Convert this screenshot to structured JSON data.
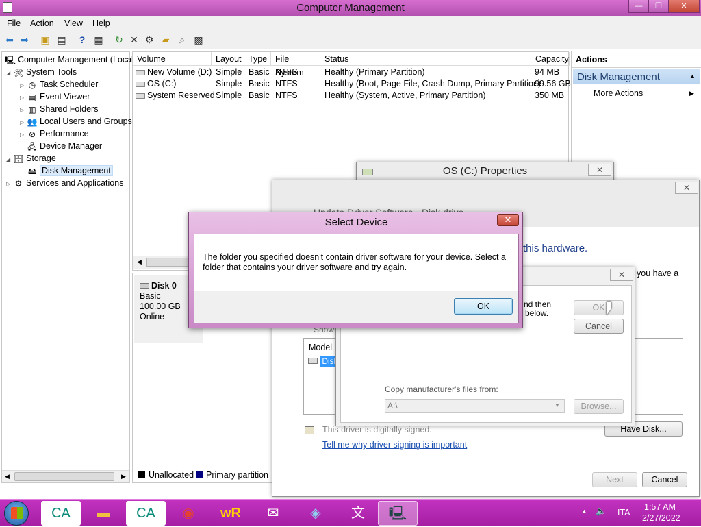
{
  "window": {
    "title": "Computer Management",
    "buttons": {
      "minimize": "—",
      "restore": "❐",
      "close": "✕"
    }
  },
  "menu": [
    "File",
    "Action",
    "View",
    "Help"
  ],
  "toolbar_icons": [
    "back-arrow-icon",
    "forward-arrow-icon",
    "up-folder-icon",
    "show-hide-tree-icon",
    "help-icon",
    "properties-icon",
    "refresh-icon",
    "delete-icon",
    "settings-icon",
    "open-folder-icon",
    "search-icon",
    "disk-icon"
  ],
  "tree": [
    {
      "label": "Computer Management (Local",
      "level": 0,
      "exp": ""
    },
    {
      "label": "System Tools",
      "level": 1,
      "exp": "◢"
    },
    {
      "label": "Task Scheduler",
      "level": 2,
      "exp": "▷"
    },
    {
      "label": "Event Viewer",
      "level": 2,
      "exp": "▷"
    },
    {
      "label": "Shared Folders",
      "level": 2,
      "exp": "▷"
    },
    {
      "label": "Local Users and Groups",
      "level": 2,
      "exp": "▷"
    },
    {
      "label": "Performance",
      "level": 2,
      "exp": "▷"
    },
    {
      "label": "Device Manager",
      "level": 2,
      "exp": ""
    },
    {
      "label": "Storage",
      "level": 1,
      "exp": "◢"
    },
    {
      "label": "Disk Management",
      "level": 2,
      "exp": "",
      "selected": true
    },
    {
      "label": "Services and Applications",
      "level": 1,
      "exp": "▷"
    }
  ],
  "volumes": {
    "headers": [
      "Volume",
      "Layout",
      "Type",
      "File System",
      "Status",
      "Capacity"
    ],
    "rows": [
      [
        "New Volume (D:)",
        "Simple",
        "Basic",
        "NTFS",
        "Healthy (Primary Partition)",
        "94 MB"
      ],
      [
        "OS (C:)",
        "Simple",
        "Basic",
        "NTFS",
        "Healthy (Boot, Page File, Crash Dump, Primary Partition)",
        "99.56 GB"
      ],
      [
        "System Reserved",
        "Simple",
        "Basic",
        "NTFS",
        "Healthy (System, Active, Primary Partition)",
        "350 MB"
      ]
    ]
  },
  "disk": {
    "name": "Disk 0",
    "type": "Basic",
    "size": "100.00 GB",
    "state": "Online"
  },
  "legend": {
    "unallocated": "Unallocated",
    "primary": "Primary partition",
    "unallocated_color": "#000000",
    "primary_color": "#000080"
  },
  "actions": {
    "header": "Actions",
    "section": "Disk Management",
    "more": "More Actions"
  },
  "properties_dialog": {
    "title": "OS (C:) Properties"
  },
  "update_driver": {
    "heading": "Update Driver Software - Disk drive",
    "hardware_text": "this hardware.",
    "have_a": "you have a",
    "model_header": "Model",
    "model_item": "Disk",
    "show": "Show",
    "signed": "This driver is digitally signed.",
    "link": "Tell me why driver signing is important",
    "have_disk": "Have Disk...",
    "next": "Next",
    "cancel": "Cancel"
  },
  "install_from_disk": {
    "text1": "nd then",
    "text2": "below.",
    "ok": "OK",
    "cancel": "Cancel",
    "copy_label": "Copy manufacturer's files from:",
    "path": "A:\\",
    "browse": "Browse..."
  },
  "select_device": {
    "title": "Select Device",
    "message": "The folder you specified doesn't contain driver software for your device. Select a folder that contains your driver software and try again.",
    "ok": "OK"
  },
  "taskbar": {
    "apps": [
      "credit-agricole-icon",
      "file-explorer-icon",
      "credit-agricole-icon",
      "chrome-icon",
      "winrar-icon",
      "gmail-icon",
      "maps-icon",
      "translate-icon",
      "computer-management-icon"
    ],
    "lang": "ITA",
    "time": "1:57 AM",
    "date": "2/27/2022"
  }
}
